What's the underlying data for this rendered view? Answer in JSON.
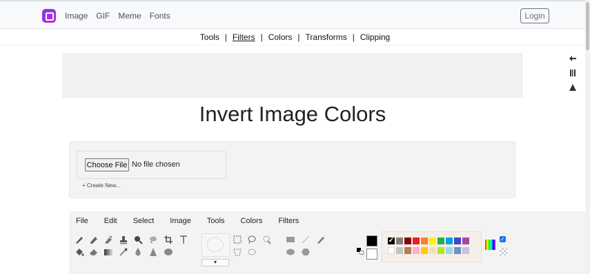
{
  "topbar": {
    "logo_icon": "image-logo-icon",
    "nav": [
      "Image",
      "GIF",
      "Meme",
      "Fonts"
    ],
    "login_label": "Login"
  },
  "subnav": {
    "items": [
      "Tools",
      "Filters",
      "Colors",
      "Transforms",
      "Clipping"
    ],
    "active": "Filters"
  },
  "page": {
    "title": "Invert Image Colors"
  },
  "upload": {
    "choose_label": "Choose File",
    "status": "No file chosen",
    "create_new": "+ Create New..."
  },
  "editor": {
    "menu": [
      "File",
      "Edit",
      "Select",
      "Image",
      "Tools",
      "Colors",
      "Filters"
    ],
    "tools_row1": [
      "brush-icon",
      "pencil-icon",
      "airbrush-icon",
      "clone-stamp-icon",
      "zoom-icon",
      "lasso-fill-icon",
      "crop-icon",
      "text-icon"
    ],
    "tools_row2": [
      "paint-bucket-icon",
      "eraser-icon",
      "gradient-icon",
      "color-picker-icon",
      "blur-drop-icon",
      "sharpen-icon",
      "smudge-icon"
    ],
    "select_tools": [
      "rect-select-icon",
      "lasso-select-icon",
      "magic-wand-icon",
      "polygon-select-icon",
      "ellipse-select-icon"
    ],
    "shape_tools": [
      "rectangle-shape-icon",
      "line-shape-icon",
      "pen-shape-icon",
      "ellipse-shape-icon",
      "polygon-shape-icon"
    ],
    "primary_color": "#000000",
    "secondary_color": "#ffffff",
    "palette_row1": [
      "#000000",
      "#7f7f7f",
      "#880015",
      "#ed1c24",
      "#ff7f27",
      "#fff200",
      "#22b14c",
      "#00a2e8",
      "#3f48cc",
      "#a349a4"
    ],
    "palette_row2": [
      "#ffffff",
      "#c3c3c3",
      "#b97a57",
      "#ffaec9",
      "#ffc90e",
      "#efe4b0",
      "#b5e61d",
      "#99d9ea",
      "#7092be",
      "#c8bfe7"
    ],
    "checkbox_checked": true
  },
  "side_tools": [
    "undo-icon",
    "barcode-icon",
    "triangle-icon"
  ]
}
